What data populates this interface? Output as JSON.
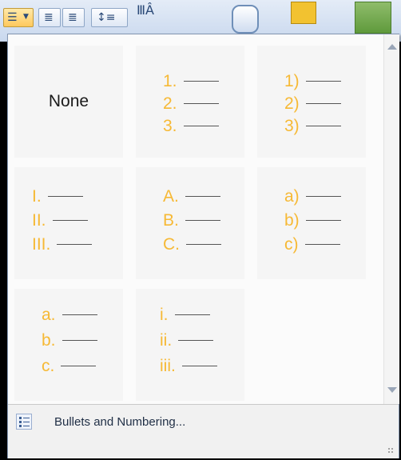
{
  "colors": {
    "accent": "#f6b935",
    "panel_bg": "#ffffff",
    "cell_bg": "#f5f5f5"
  },
  "ribbon": {
    "icons": [
      "numbering-icon",
      "dropdown-arrow-icon",
      "decrease-indent-icon",
      "increase-indent-icon",
      "line-spacing-icon",
      "text-direction-icon",
      "shape-cylinder-icon",
      "arrange-icon",
      "quick-styles-icon"
    ]
  },
  "gallery": {
    "none_label": "None",
    "formats": [
      {
        "markers": [
          "1.",
          "2.",
          "3."
        ]
      },
      {
        "markers": [
          "1)",
          "2)",
          "3)"
        ]
      },
      {
        "markers": [
          "I.",
          "II.",
          "III."
        ]
      },
      {
        "markers": [
          "A.",
          "B.",
          "C."
        ]
      },
      {
        "markers": [
          "a)",
          "b)",
          "c)"
        ]
      },
      {
        "markers": [
          "a.",
          "b.",
          "c."
        ]
      },
      {
        "markers": [
          "i.",
          "ii.",
          "iii."
        ]
      }
    ]
  },
  "footer": {
    "command_label": "Bullets and Numbering..."
  }
}
